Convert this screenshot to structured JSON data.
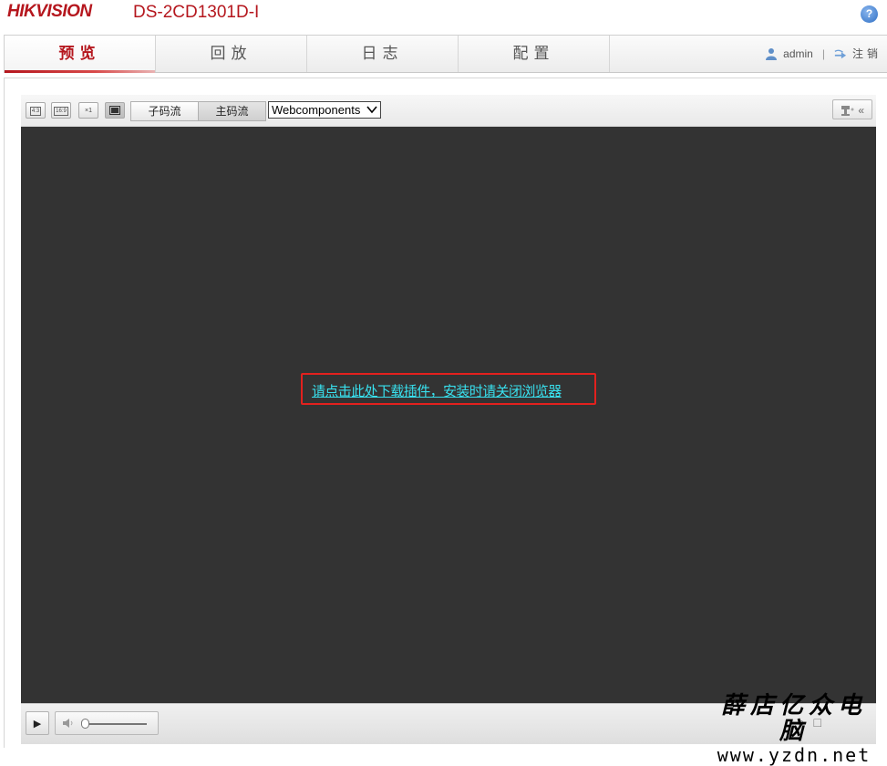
{
  "header": {
    "logo": "HIKVISION",
    "model": "DS-2CD1301D-I",
    "help_glyph": "?"
  },
  "nav": {
    "tabs": [
      {
        "label": "预览",
        "active": true
      },
      {
        "label": "回放",
        "active": false
      },
      {
        "label": "日志",
        "active": false
      },
      {
        "label": "配置",
        "active": false
      }
    ],
    "user": "admin",
    "separator": "|",
    "logout": "注销"
  },
  "toolbar": {
    "ratios": [
      "4:3",
      "16:9",
      "×1",
      ""
    ],
    "sub_stream": "子码流",
    "main_stream": "主码流",
    "plugin_select": "Webcomponents",
    "collapse_glyph": "«"
  },
  "video": {
    "plugin_link": "请点击此处下载插件，安装时请关闭浏览器",
    "highlight_color": "#e3211e",
    "link_color": "#38e0ee"
  },
  "controls": {
    "play_glyph": "▶",
    "volume_level": 0
  },
  "watermark": {
    "title": "薛店亿众电脑",
    "url": "www.yzdn.net"
  },
  "colors": {
    "brand": "#b5171e",
    "video_bg": "#333333"
  }
}
